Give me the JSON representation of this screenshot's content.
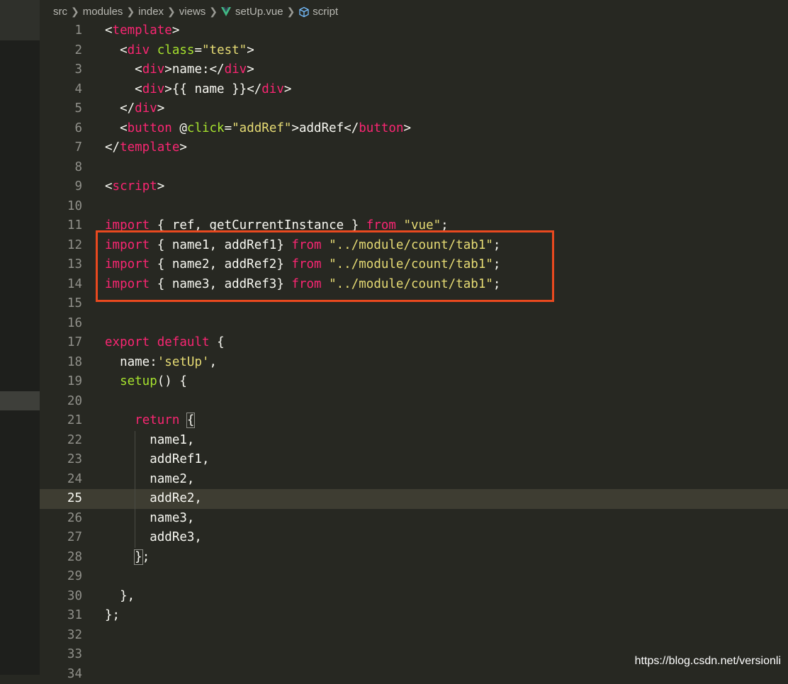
{
  "breadcrumb": {
    "items": [
      "src",
      "modules",
      "index",
      "views",
      "setUp.vue",
      "script"
    ]
  },
  "editor": {
    "current_line": 25,
    "lines": [
      {
        "n": "1",
        "tokens": [
          [
            "p",
            "<"
          ],
          [
            "k",
            "template"
          ],
          [
            "p",
            ">"
          ]
        ]
      },
      {
        "n": "2",
        "tokens": [
          [
            "p",
            "  <"
          ],
          [
            "k",
            "div"
          ],
          [
            "p",
            " "
          ],
          [
            "a",
            "class"
          ],
          [
            "p",
            "="
          ],
          [
            "s",
            "\"test\""
          ],
          [
            "p",
            ">"
          ]
        ]
      },
      {
        "n": "3",
        "tokens": [
          [
            "p",
            "    <"
          ],
          [
            "k",
            "div"
          ],
          [
            "p",
            ">name:</"
          ],
          [
            "k",
            "div"
          ],
          [
            "p",
            ">"
          ]
        ]
      },
      {
        "n": "4",
        "tokens": [
          [
            "p",
            "    <"
          ],
          [
            "k",
            "div"
          ],
          [
            "p",
            ">{{ name }}</"
          ],
          [
            "k",
            "div"
          ],
          [
            "p",
            ">"
          ]
        ]
      },
      {
        "n": "5",
        "tokens": [
          [
            "p",
            "  </"
          ],
          [
            "k",
            "div"
          ],
          [
            "p",
            ">"
          ]
        ]
      },
      {
        "n": "6",
        "tokens": [
          [
            "p",
            "  <"
          ],
          [
            "k",
            "button"
          ],
          [
            "p",
            " @"
          ],
          [
            "a",
            "click"
          ],
          [
            "p",
            "="
          ],
          [
            "s",
            "\"addRef\""
          ],
          [
            "p",
            ">addRef</"
          ],
          [
            "k",
            "button"
          ],
          [
            "p",
            ">"
          ]
        ]
      },
      {
        "n": "7",
        "tokens": [
          [
            "p",
            "</"
          ],
          [
            "k",
            "template"
          ],
          [
            "p",
            ">"
          ]
        ]
      },
      {
        "n": "8",
        "tokens": []
      },
      {
        "n": "9",
        "tokens": [
          [
            "p",
            "<"
          ],
          [
            "k",
            "script"
          ],
          [
            "p",
            ">"
          ]
        ]
      },
      {
        "n": "10",
        "tokens": []
      },
      {
        "n": "11",
        "tokens": [
          [
            "k",
            "import"
          ],
          [
            "p",
            " { ref, getCurrentInstance } "
          ],
          [
            "k",
            "from"
          ],
          [
            "p",
            " "
          ],
          [
            "s",
            "\"vue\""
          ],
          [
            "p",
            ";"
          ]
        ]
      },
      {
        "n": "12",
        "tokens": [
          [
            "k",
            "import"
          ],
          [
            "p",
            " { name1, addRef1} "
          ],
          [
            "k",
            "from"
          ],
          [
            "p",
            " "
          ],
          [
            "s",
            "\"../module/count/tab1\""
          ],
          [
            "p",
            ";"
          ]
        ]
      },
      {
        "n": "13",
        "tokens": [
          [
            "k",
            "import"
          ],
          [
            "p",
            " { name2, addRef2} "
          ],
          [
            "k",
            "from"
          ],
          [
            "p",
            " "
          ],
          [
            "s",
            "\"../module/count/tab1\""
          ],
          [
            "p",
            ";"
          ]
        ]
      },
      {
        "n": "14",
        "tokens": [
          [
            "k",
            "import"
          ],
          [
            "p",
            " { name3, addRef3} "
          ],
          [
            "k",
            "from"
          ],
          [
            "p",
            " "
          ],
          [
            "s",
            "\"../module/count/tab1\""
          ],
          [
            "p",
            ";"
          ]
        ]
      },
      {
        "n": "15",
        "tokens": []
      },
      {
        "n": "16",
        "tokens": []
      },
      {
        "n": "17",
        "tokens": [
          [
            "k",
            "export"
          ],
          [
            "p",
            " "
          ],
          [
            "k",
            "default"
          ],
          [
            "p",
            " {"
          ]
        ]
      },
      {
        "n": "18",
        "tokens": [
          [
            "p",
            "  name:"
          ],
          [
            "s",
            "'setUp'"
          ],
          [
            "p",
            ","
          ]
        ]
      },
      {
        "n": "19",
        "tokens": [
          [
            "p",
            "  "
          ],
          [
            "a",
            "setup"
          ],
          [
            "p",
            "() {"
          ]
        ]
      },
      {
        "n": "20",
        "tokens": []
      },
      {
        "n": "21",
        "tokens": [
          [
            "p",
            "    "
          ],
          [
            "k",
            "return"
          ],
          [
            "p",
            " "
          ],
          [
            "b",
            "{"
          ]
        ]
      },
      {
        "n": "22",
        "tokens": [
          [
            "p",
            "      name1,"
          ]
        ]
      },
      {
        "n": "23",
        "tokens": [
          [
            "p",
            "      addRef1,"
          ]
        ]
      },
      {
        "n": "24",
        "tokens": [
          [
            "p",
            "      name2,"
          ]
        ]
      },
      {
        "n": "25",
        "tokens": [
          [
            "p",
            "      addRe2,"
          ]
        ]
      },
      {
        "n": "26",
        "tokens": [
          [
            "p",
            "      name3,"
          ]
        ]
      },
      {
        "n": "27",
        "tokens": [
          [
            "p",
            "      addRe3,"
          ]
        ]
      },
      {
        "n": "28",
        "tokens": [
          [
            "p",
            "    "
          ],
          [
            "b",
            "}"
          ],
          [
            "p",
            ";"
          ]
        ]
      },
      {
        "n": "29",
        "tokens": []
      },
      {
        "n": "30",
        "tokens": [
          [
            "p",
            "  },"
          ]
        ]
      },
      {
        "n": "31",
        "tokens": [
          [
            "p",
            "};"
          ]
        ]
      },
      {
        "n": "32",
        "tokens": []
      },
      {
        "n": "33",
        "tokens": []
      },
      {
        "n": "34",
        "tokens": []
      }
    ]
  },
  "watermark": "https://blog.csdn.net/versionli",
  "colors": {
    "background": "#272822",
    "keyword": "#f92672",
    "attribute": "#a6e22e",
    "string": "#e6db74",
    "highlight_box": "#e9491f"
  }
}
